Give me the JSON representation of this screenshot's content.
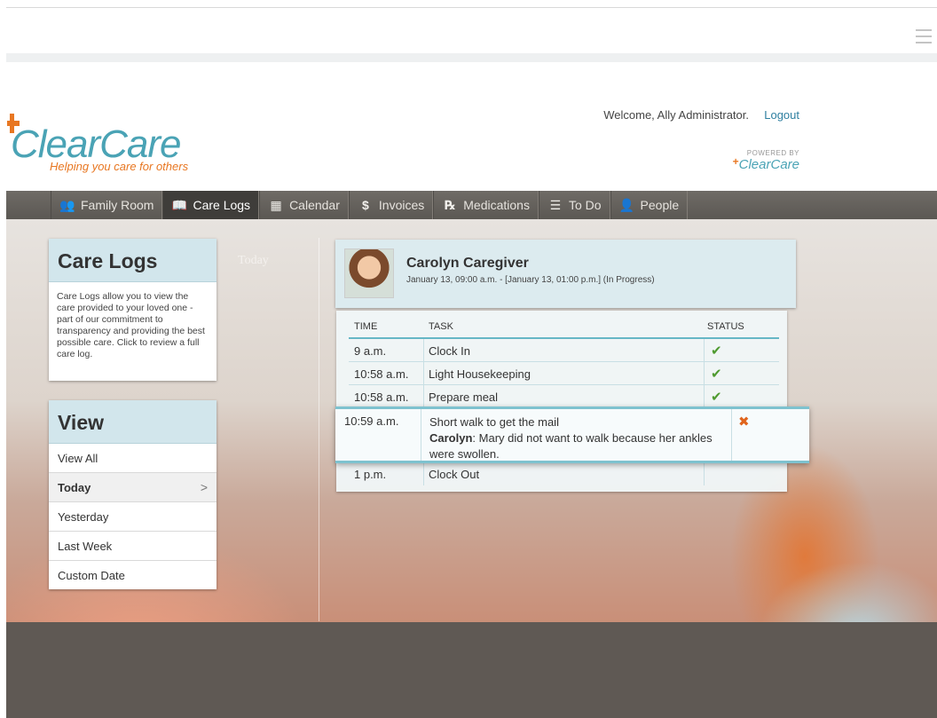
{
  "header": {
    "welcome_text": "Welcome, Ally Administrator.",
    "logout_label": "Logout",
    "logo_name": "ClearCare",
    "logo_tagline": "Helping you care for others",
    "powered_by_label": "POWERED BY",
    "powered_by_brand": "ClearCare"
  },
  "nav": {
    "items": [
      {
        "label": "Family Room",
        "icon": "family-icon"
      },
      {
        "label": "Care Logs",
        "icon": "book-icon"
      },
      {
        "label": "Calendar",
        "icon": "calendar-icon"
      },
      {
        "label": "Invoices",
        "icon": "dollar-icon"
      },
      {
        "label": "Medications",
        "icon": "rx-icon"
      },
      {
        "label": "To Do",
        "icon": "list-icon"
      },
      {
        "label": "People",
        "icon": "person-icon"
      }
    ],
    "active": "Care Logs"
  },
  "care_logs": {
    "title": "Care Logs",
    "description": "Care Logs allow you to view the care provided to your loved one - part of our commitment to transparency and providing the best possible care. Click to review a full care log."
  },
  "view": {
    "title": "View",
    "items": [
      "View All",
      "Today",
      "Yesterday",
      "Last Week",
      "Custom Date"
    ],
    "selected": "Today"
  },
  "date_heading": "Today",
  "caregiver": {
    "name": "Carolyn Caregiver",
    "shift": "January 13, 09:00 a.m. - [January 13, 01:00 p.m.] (In Progress)"
  },
  "log_table": {
    "columns": [
      "TIME",
      "TASK",
      "STATUS"
    ],
    "rows": [
      {
        "time": "9 a.m.",
        "task": "Clock In",
        "status": "✔"
      },
      {
        "time": "10:58 a.m.",
        "task": "Light Housekeeping",
        "status": "✔"
      },
      {
        "time": "10:58 a.m.",
        "task": "Prepare meal",
        "status": "✔"
      }
    ],
    "expanded_row": {
      "time": "10:59 a.m.",
      "task": "Short walk to get the mail",
      "note_author": "Carolyn",
      "note_text": ": Mary did not want to walk because her ankles were swollen.",
      "status": "✖"
    },
    "last_row": {
      "time": "1 p.m.",
      "task": "Clock Out",
      "status": ""
    }
  },
  "colors": {
    "brand_teal": "#4aa3b5",
    "brand_orange": "#e87722",
    "nav_bg": "#5f5b56",
    "panel_head": "#d2e6ec",
    "status_ok": "#4e9a2f",
    "status_fail": "#e0651e"
  }
}
